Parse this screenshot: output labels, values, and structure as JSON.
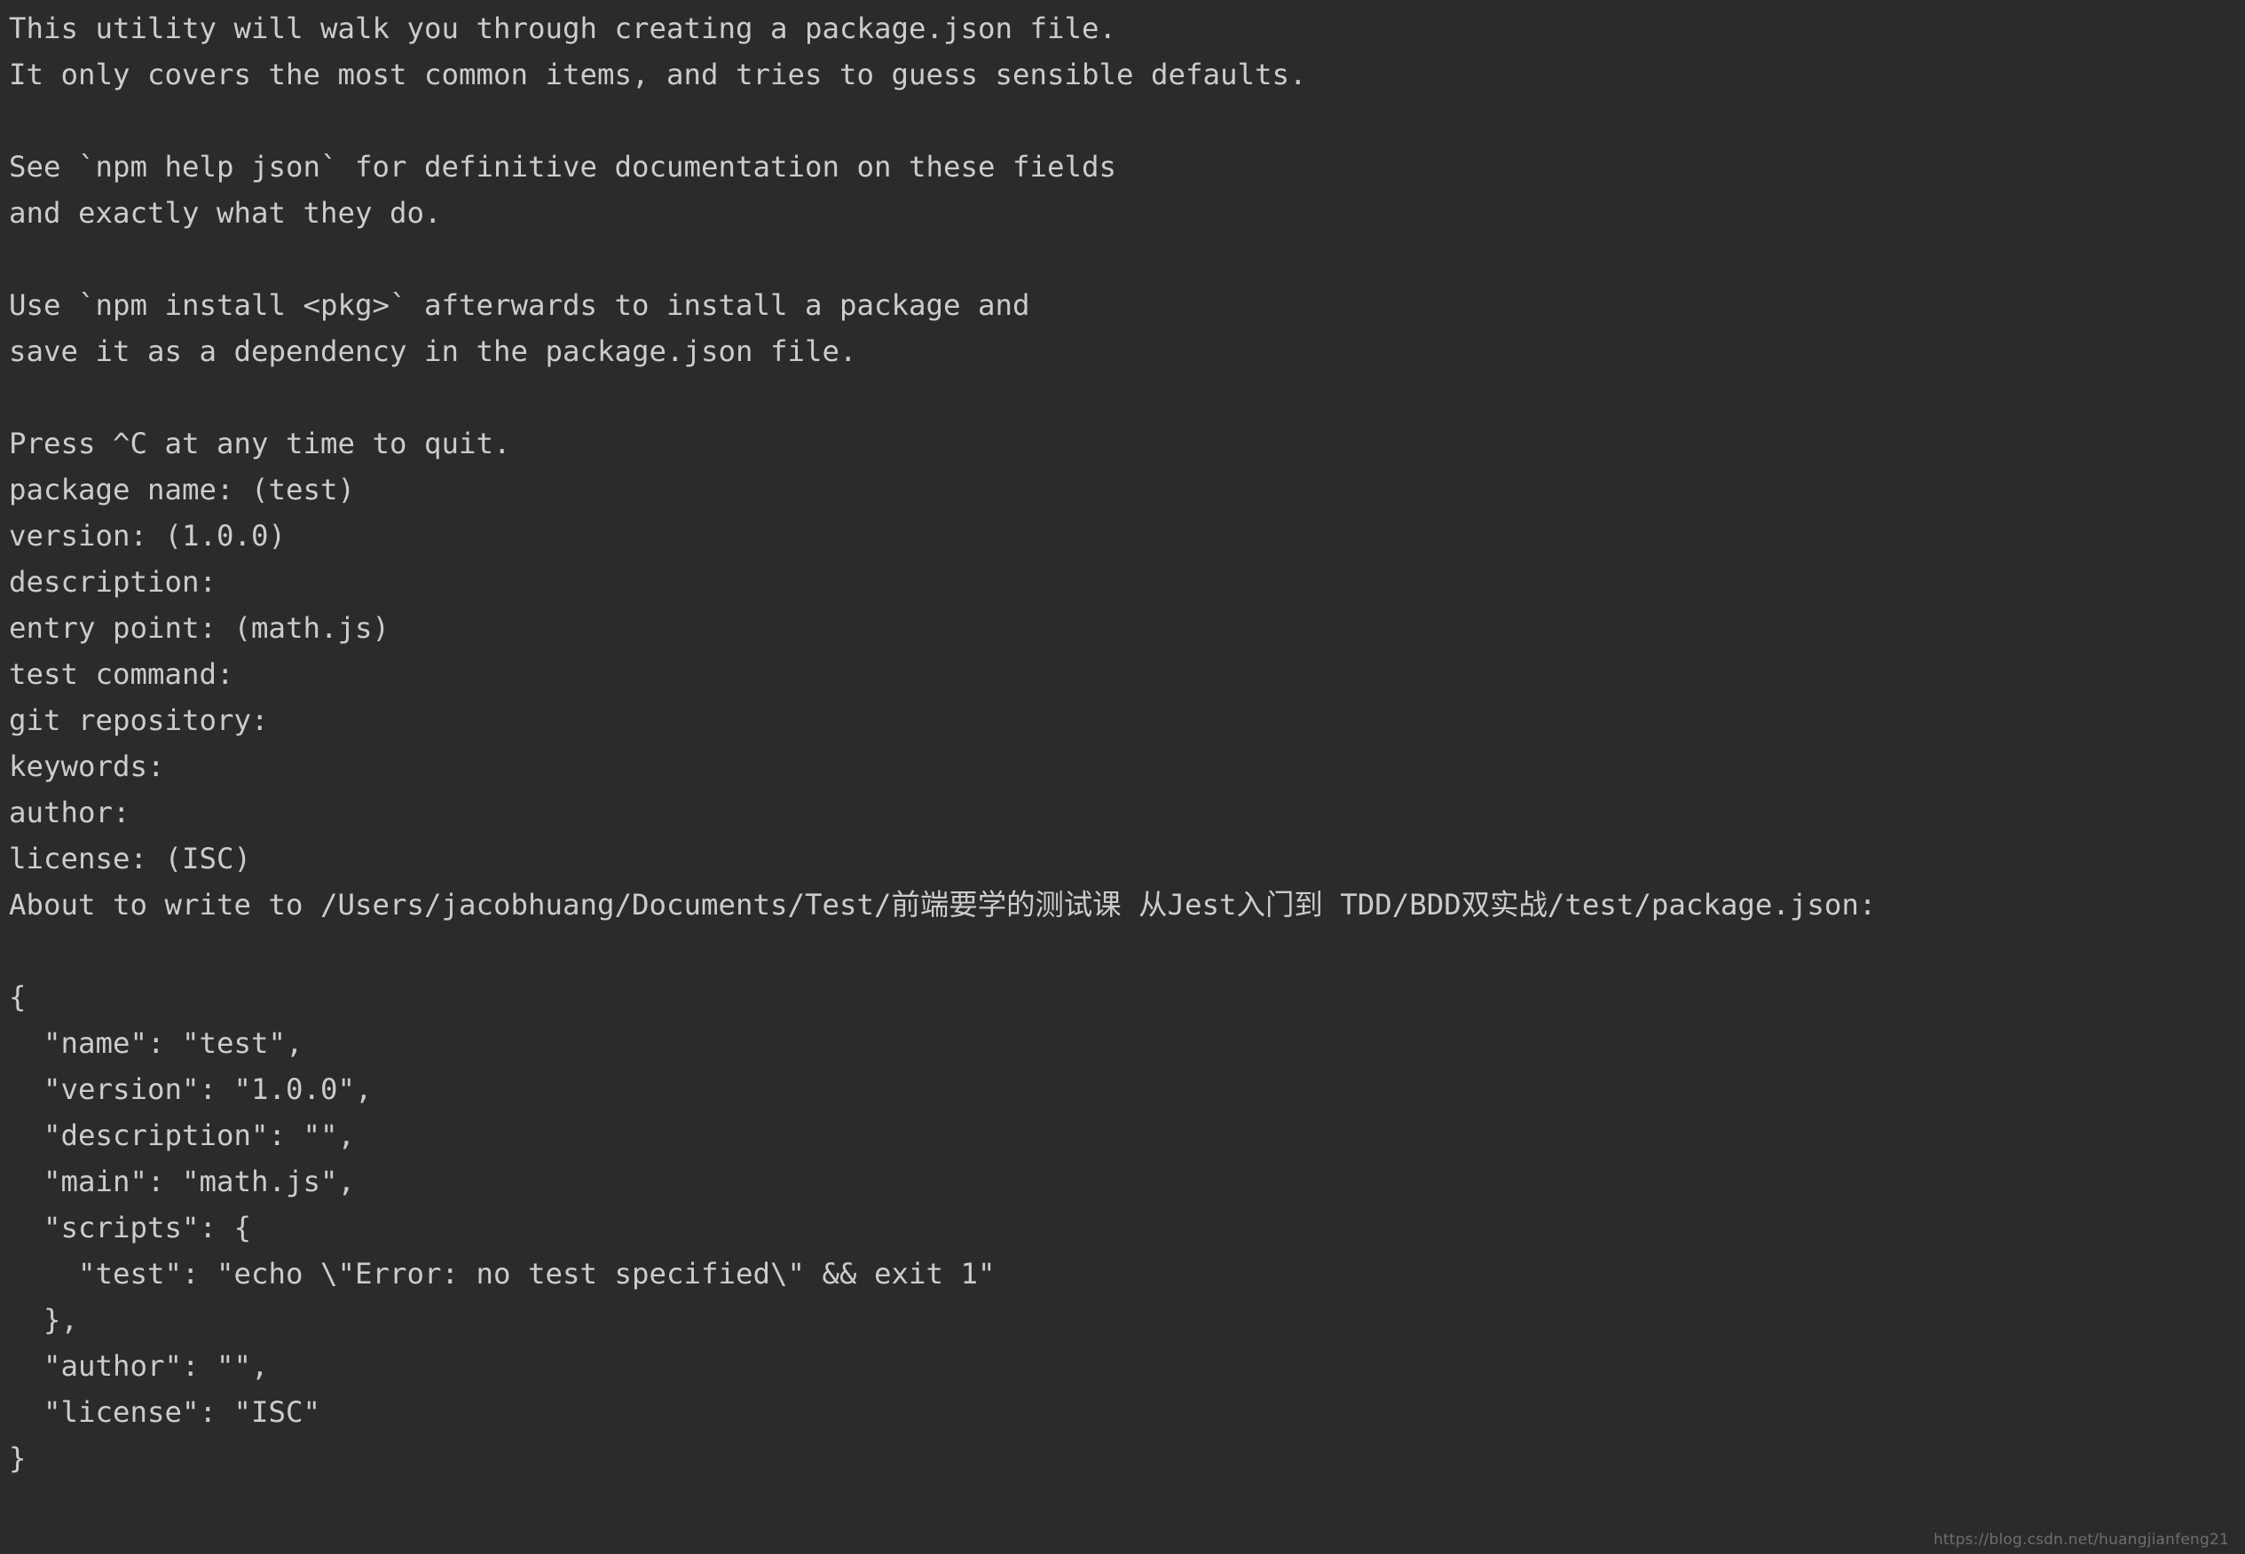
{
  "terminal": {
    "background_color": "#2b2b2b",
    "text_color": "#cccccc",
    "lines": [
      {
        "id": "intro-1",
        "text": "This utility will walk you through creating a package.json file."
      },
      {
        "id": "intro-2",
        "text": "It only covers the most common items, and tries to guess sensible defaults."
      },
      {
        "id": "blank-1",
        "text": ""
      },
      {
        "id": "help-1",
        "text": "See `npm help json` for definitive documentation on these fields"
      },
      {
        "id": "help-2",
        "text": "and exactly what they do."
      },
      {
        "id": "blank-2",
        "text": ""
      },
      {
        "id": "install-1",
        "text": "Use `npm install <pkg>` afterwards to install a package and"
      },
      {
        "id": "install-2",
        "text": "save it as a dependency in the package.json file."
      },
      {
        "id": "blank-3",
        "text": ""
      },
      {
        "id": "quit-hint",
        "text": "Press ^C at any time to quit."
      },
      {
        "id": "prompt-package-name",
        "text": "package name: (test)"
      },
      {
        "id": "prompt-version",
        "text": "version: (1.0.0)"
      },
      {
        "id": "prompt-description",
        "text": "description:"
      },
      {
        "id": "prompt-entry-point",
        "text": "entry point: (math.js)"
      },
      {
        "id": "prompt-test-command",
        "text": "test command:"
      },
      {
        "id": "prompt-git-repository",
        "text": "git repository:"
      },
      {
        "id": "prompt-keywords",
        "text": "keywords:"
      },
      {
        "id": "prompt-author",
        "text": "author:"
      },
      {
        "id": "prompt-license",
        "text": "license: (ISC)"
      },
      {
        "id": "about-to-write",
        "text": "About to write to /Users/jacobhuang/Documents/Test/前端要学的测试课 从Jest入门到 TDD/BDD双实战/test/package.json:"
      },
      {
        "id": "blank-4",
        "text": ""
      },
      {
        "id": "json-open-brace",
        "text": "{"
      },
      {
        "id": "json-name",
        "text": "  \"name\": \"test\","
      },
      {
        "id": "json-version",
        "text": "  \"version\": \"1.0.0\","
      },
      {
        "id": "json-description",
        "text": "  \"description\": \"\","
      },
      {
        "id": "json-main",
        "text": "  \"main\": \"math.js\","
      },
      {
        "id": "json-scripts-open",
        "text": "  \"scripts\": {"
      },
      {
        "id": "json-scripts-test",
        "text": "    \"test\": \"echo \\\"Error: no test specified\\\" && exit 1\""
      },
      {
        "id": "json-scripts-close",
        "text": "  },"
      },
      {
        "id": "json-author",
        "text": "  \"author\": \"\","
      },
      {
        "id": "json-license",
        "text": "  \"license\": \"ISC\""
      },
      {
        "id": "json-close-brace",
        "text": "}"
      }
    ]
  },
  "watermark": {
    "text": "https://blog.csdn.net/huangjianfeng21"
  }
}
